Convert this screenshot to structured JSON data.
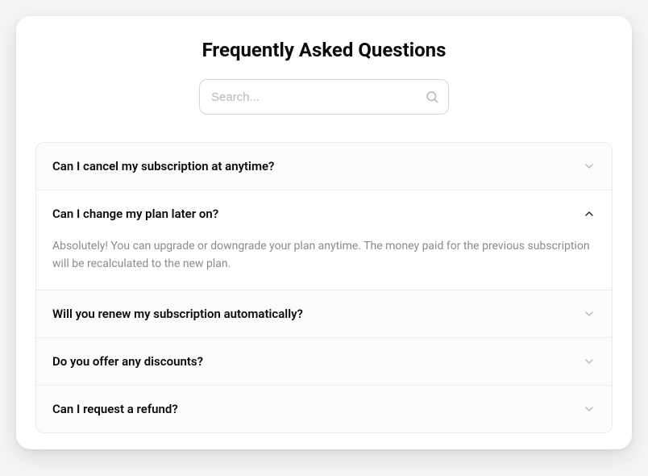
{
  "title": "Frequently Asked Questions",
  "search": {
    "placeholder": "Search..."
  },
  "faq": [
    {
      "question": "Can I cancel my subscription at anytime?",
      "expanded": false,
      "answer": ""
    },
    {
      "question": "Can I change my plan later on?",
      "expanded": true,
      "answer": "Absolutely! You can upgrade or downgrade your plan anytime. The money paid for the previous subscription will be recalculated to the new plan."
    },
    {
      "question": "Will you renew my subscription automatically?",
      "expanded": false,
      "answer": ""
    },
    {
      "question": "Do you offer any discounts?",
      "expanded": false,
      "answer": ""
    },
    {
      "question": "Can I request a refund?",
      "expanded": false,
      "answer": ""
    }
  ]
}
